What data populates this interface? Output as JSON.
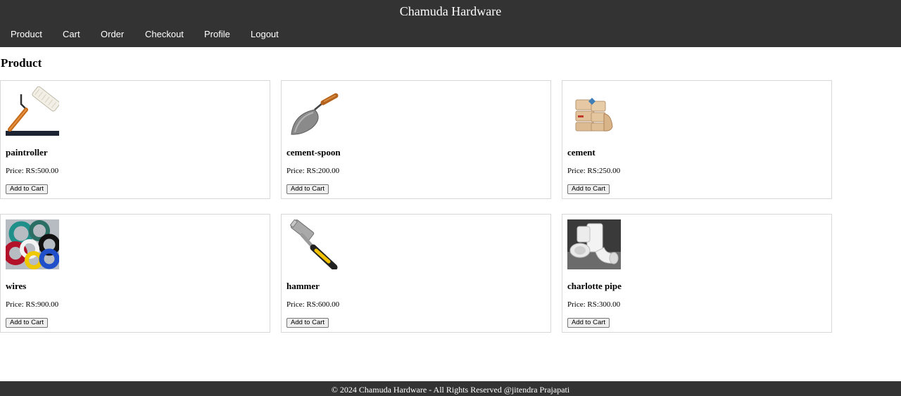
{
  "header": {
    "title": "Chamuda Hardware",
    "nav": [
      "Product",
      "Cart",
      "Order",
      "Checkout",
      "Profile",
      "Logout"
    ]
  },
  "main": {
    "heading": "Product",
    "products": [
      {
        "name": "paintroller",
        "price_label": "Price: RS:500.00",
        "button": "Add to Cart",
        "icon": "paint-roller-icon"
      },
      {
        "name": "cement-spoon",
        "price_label": "Price: RS:200.00",
        "button": "Add to Cart",
        "icon": "trowel-icon"
      },
      {
        "name": "cement",
        "price_label": "Price: RS:250.00",
        "button": "Add to Cart",
        "icon": "cement-bags-icon"
      },
      {
        "name": "wires",
        "price_label": "Price: RS:900.00",
        "button": "Add to Cart",
        "icon": "wire-coils-icon"
      },
      {
        "name": "hammer",
        "price_label": "Price: RS:600.00",
        "button": "Add to Cart",
        "icon": "hammer-icon"
      },
      {
        "name": "charlotte pipe",
        "price_label": "Price: RS:300.00",
        "button": "Add to Cart",
        "icon": "pipe-fittings-icon"
      }
    ]
  },
  "footer": {
    "text": "© 2024 Chamuda Hardware - All Rights Reserved @jitendra Prajapati"
  },
  "colors": {
    "header_bg": "#333333",
    "footer_bg": "#333333",
    "card_border": "#d8d8d8"
  }
}
